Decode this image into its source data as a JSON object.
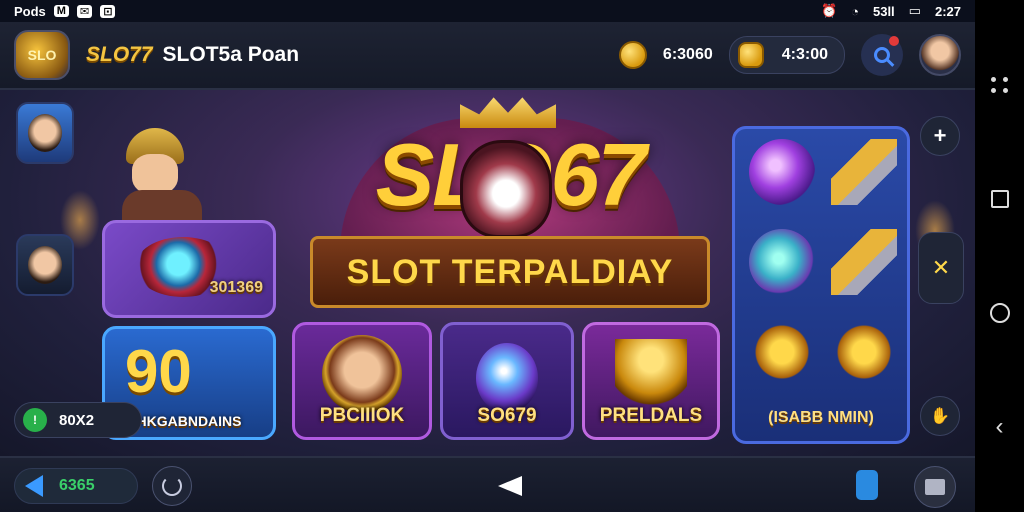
{
  "status_bar": {
    "left_text": "Pods",
    "left_icons": [
      "signal-icon",
      "mail-icon",
      "app-icon"
    ],
    "signal": "53ll",
    "time": "2:27"
  },
  "header": {
    "logo_text": "SLO",
    "brand": "SLO77",
    "subtitle": "SLOT5a Poan",
    "coin_balance": "6:3060",
    "wallet_balance": "4:3:00"
  },
  "hero": {
    "title": "SLO67",
    "banner": "SLOT TERPALDIAY"
  },
  "tiles": {
    "gem": "301369",
    "blue_big": "90",
    "blue_label": "HKGABNDAINS",
    "p_label": "PBCIIIOK",
    "gem2_label": "SO679",
    "pr_label": "PRELDALS",
    "grid_label": "(ISABB NMIN)"
  },
  "chip": {
    "badge": "!",
    "text": "80X2"
  },
  "bottom": {
    "amount": "6365"
  },
  "colors": {
    "gold": "#ffcf3a",
    "accent_blue": "#3a9aff",
    "accent_green": "#3ad06a",
    "header_bg": "#1e2333"
  }
}
